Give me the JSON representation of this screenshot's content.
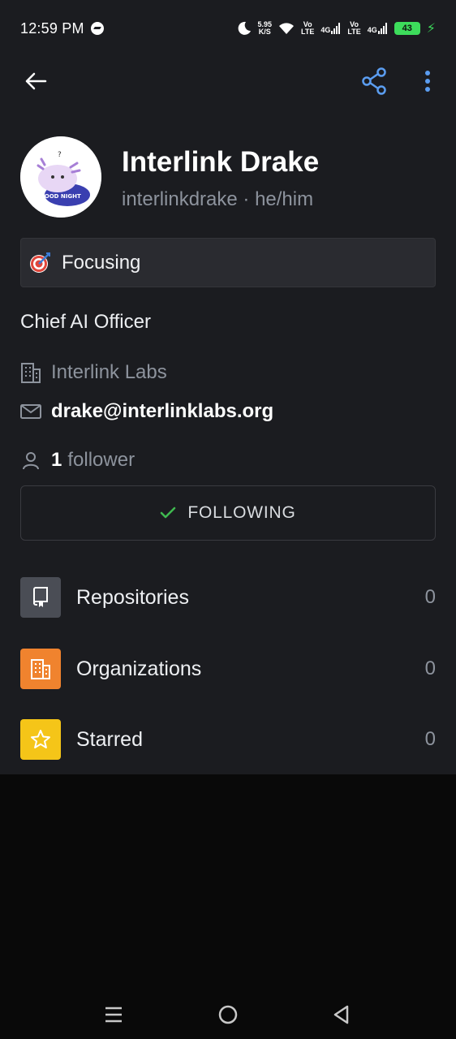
{
  "status_bar": {
    "time": "12:59 PM",
    "net_speed_value": "5.95",
    "net_speed_unit": "K/S",
    "sim1_label_top": "Vo",
    "sim1_label_bottom": "LTE",
    "sim1_network": "4G",
    "sim2_label_top": "Vo",
    "sim2_label_bottom": "LTE",
    "sim2_network": "4G",
    "battery_level": "43",
    "icons": [
      "messenger-icon",
      "moon-icon",
      "wifi-icon",
      "signal-icon",
      "battery-icon",
      "charging-icon"
    ]
  },
  "toolbar": {
    "back_icon": "arrow-left-icon",
    "share_icon": "share-icon",
    "more_icon": "more-vertical-icon"
  },
  "profile": {
    "avatar_text": "GOOD NIGHT",
    "display_name": "Interlink Drake",
    "handle_line": "interlinkdrake · he/him",
    "status_text": "Focusing",
    "status_icon": "dart-target-icon",
    "bio": "Chief AI Officer",
    "company": "Interlink Labs",
    "email": "drake@interlinklabs.org",
    "follower_count": "1",
    "follower_label": "follower"
  },
  "follow_button": {
    "label": "FOLLOWING"
  },
  "menu": [
    {
      "label": "Repositories",
      "count": "0",
      "icon": "repo-icon",
      "color": "#4a4d55"
    },
    {
      "label": "Organizations",
      "count": "0",
      "icon": "organization-icon",
      "color": "#f0832e"
    },
    {
      "label": "Starred",
      "count": "0",
      "icon": "star-icon",
      "color": "#f5c518"
    }
  ],
  "colors": {
    "accent_blue": "#5b9df0",
    "check_green": "#3fb950",
    "background": "#1b1c20"
  }
}
